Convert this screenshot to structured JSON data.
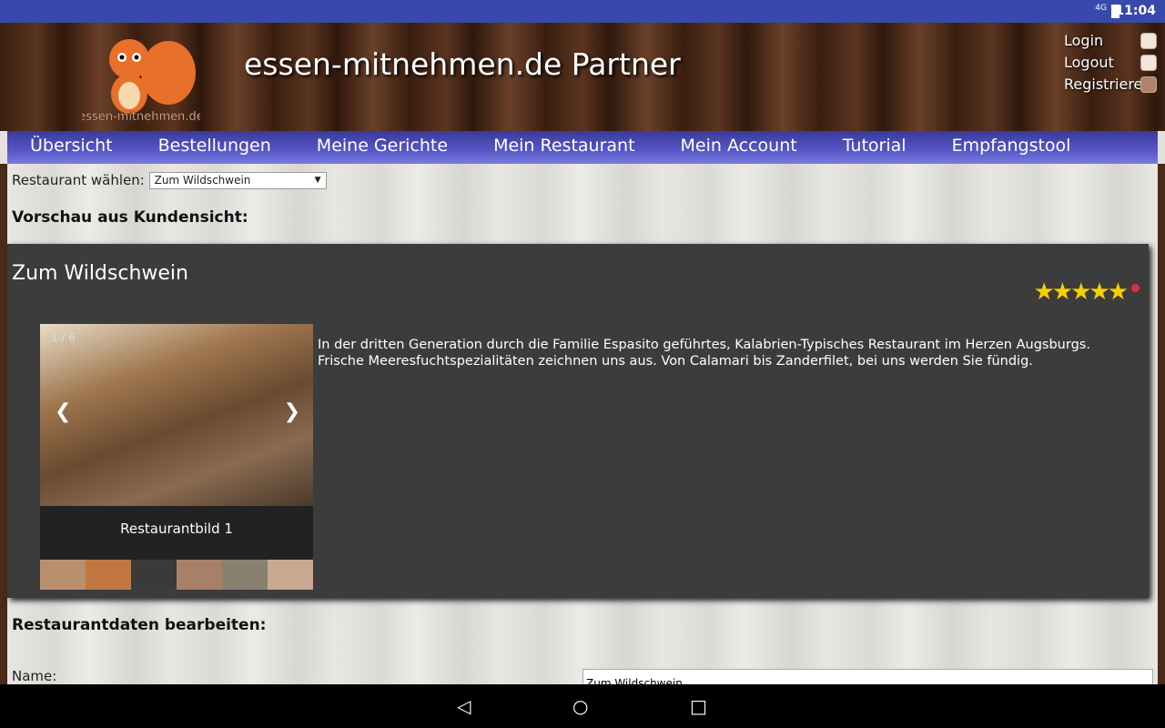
{
  "status_bar": {
    "network": "4G",
    "time": "11:04"
  },
  "header": {
    "logo_text": "essen-mitnehmen.de",
    "title": "essen-mitnehmen.de Partner",
    "auth": [
      {
        "label": "Login",
        "icon": "chair-icon"
      },
      {
        "label": "Logout",
        "icon": "bed-icon"
      },
      {
        "label": "Registrieren",
        "icon": "calendar-icon"
      }
    ]
  },
  "nav": {
    "items": [
      "Übersicht",
      "Bestellungen",
      "Meine Gerichte",
      "Mein Restaurant",
      "Mein Account",
      "Tutorial",
      "Empfangstool"
    ],
    "gradient": "#5656c8"
  },
  "selector": {
    "label": "Restaurant wählen:",
    "value": "Zum Wildschwein"
  },
  "preview_heading": "Vorschau aus Kundensicht:",
  "card": {
    "name": "Zum Wildschwein",
    "rating": 5,
    "rating_max": 5,
    "gallery": {
      "counter": "1 / 6",
      "caption": "Restaurantbild 1",
      "prev": "❮",
      "next": "❯",
      "thumb_count": 6
    },
    "description": "In der dritten Generation durch die Familie Espasito geführtes, Kalabrien-Typisches Restaurant im Herzen Augsburgs. Frische Meeresfuchtspezialitäten zeichnen uns aus. Von Calamari bis Zanderfilet, bei uns werden Sie fündig."
  },
  "edit_heading": "Restaurantdaten bearbeiten:",
  "form": {
    "name_label": "Name:",
    "name_value": "Zum Wildschwein"
  }
}
